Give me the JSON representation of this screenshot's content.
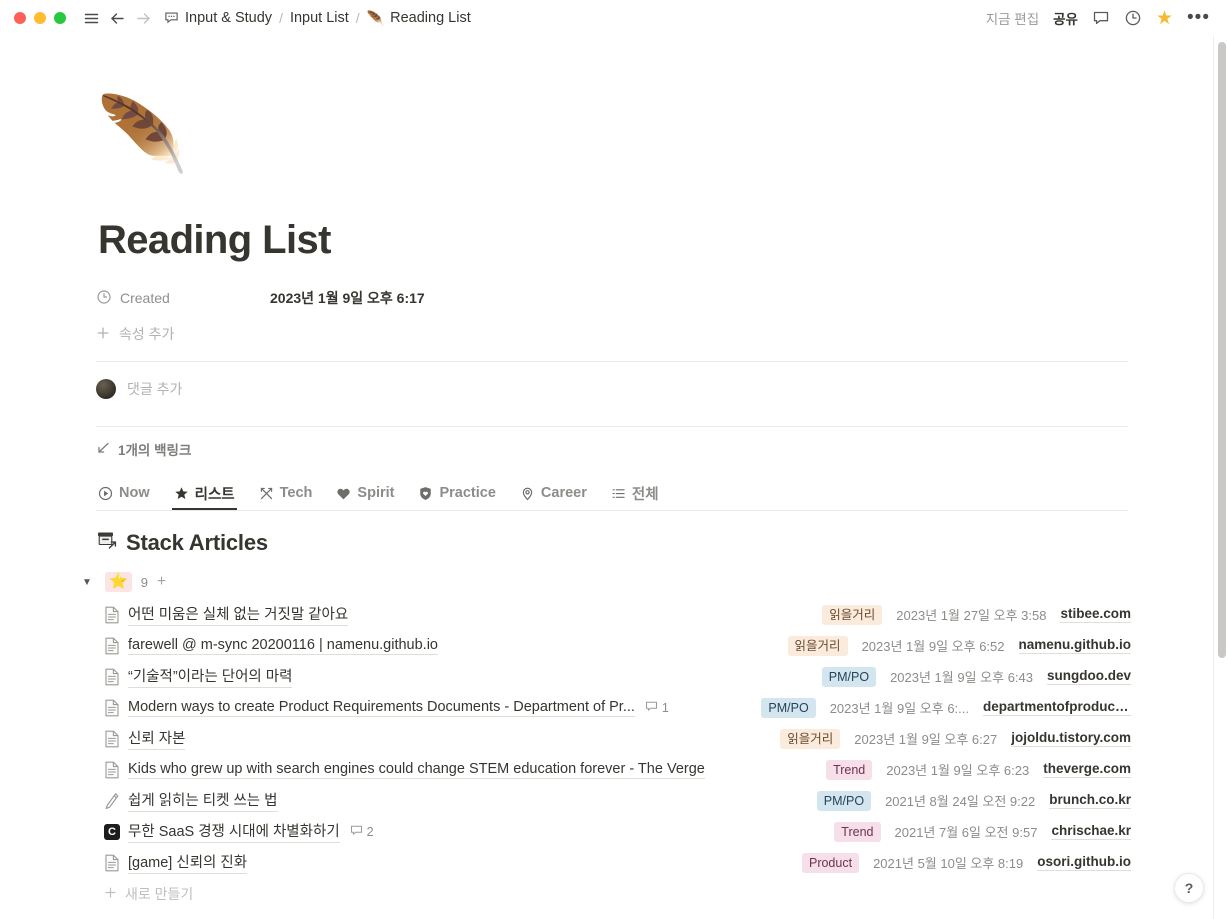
{
  "window": {
    "traffic_lights": [
      "close",
      "minimize",
      "zoom"
    ],
    "nav": {
      "menu": "hamburger-icon",
      "back": "back-arrow-icon",
      "forward": "forward-arrow-icon"
    },
    "breadcrumb": [
      {
        "icon": "speech-bubble",
        "label": "Input & Study"
      },
      {
        "icon": "",
        "label": "Input List"
      },
      {
        "icon": "feather",
        "label": "Reading List"
      }
    ],
    "separator": "/",
    "right": {
      "edit_status": "지금 편집",
      "share": "공유",
      "comment_icon": "comment-icon",
      "history_icon": "clock-history-icon",
      "favorite_icon": "star-icon",
      "more_icon": "more-horizontal-icon"
    }
  },
  "page": {
    "emoji": "🪶",
    "title": "Reading List",
    "properties": [
      {
        "icon": "clock-icon",
        "label": "Created",
        "value": "2023년 1월 9일 오후 6:17"
      }
    ],
    "add_property": "속성 추가",
    "comment_placeholder": "댓글 추가",
    "backlinks": "1개의 백링크"
  },
  "tabs": [
    {
      "icon": "play-circle",
      "label": "Now",
      "active": false
    },
    {
      "icon": "star",
      "label": "리스트",
      "active": true
    },
    {
      "icon": "crossed-arrows",
      "label": "Tech",
      "active": false
    },
    {
      "icon": "heart",
      "label": "Spirit",
      "active": false
    },
    {
      "icon": "shield-heart",
      "label": "Practice",
      "active": false
    },
    {
      "icon": "map-pin",
      "label": "Career",
      "active": false
    },
    {
      "icon": "list",
      "label": "전체",
      "active": false
    }
  ],
  "section": {
    "emoji": "🗃",
    "heading": "Stack Articles",
    "group": {
      "badge_emoji": "⭐",
      "count": "9",
      "add": "+"
    },
    "new_label": "새로 만들기"
  },
  "colors": {
    "tag_orange_bg": "#faebdd",
    "tag_orange_fg": "#6b4b2f",
    "tag_blue_bg": "#d3e5ef",
    "tag_blue_fg": "#27435a",
    "tag_pink_bg": "#f6dfe8",
    "tag_pink_fg": "#6b3550",
    "accent_star": "#f5b932"
  },
  "rows": [
    {
      "icon": "document",
      "title": "어떤 미움은 실체 없는 거짓말 같아요",
      "comments": "",
      "tag": "읽을거리",
      "tag_color": "orange",
      "date": "2023년 1월 27일 오후 3:58",
      "domain": "stibee.com"
    },
    {
      "icon": "document",
      "title": "farewell @ m-sync 20200116 | namenu.github.io",
      "comments": "",
      "tag": "읽을거리",
      "tag_color": "orange",
      "date": "2023년 1월 9일 오후 6:52",
      "domain": "namenu.github.io"
    },
    {
      "icon": "document",
      "title": "“기술적”이라는 단어의 마력",
      "comments": "",
      "tag": "PM/PO",
      "tag_color": "blue",
      "date": "2023년 1월 9일 오후 6:43",
      "domain": "sungdoo.dev"
    },
    {
      "icon": "document",
      "title": "Modern ways to create Product Requirements Documents - Department of Pr...",
      "comments": "1",
      "tag": "PM/PO",
      "tag_color": "blue",
      "date": "2023년 1월 9일 오후 6:...",
      "domain": "departmentofproduct.c..."
    },
    {
      "icon": "document",
      "title": "신뢰 자본",
      "comments": "",
      "tag": "읽을거리",
      "tag_color": "orange",
      "date": "2023년 1월 9일 오후 6:27",
      "domain": "jojoldu.tistory.com"
    },
    {
      "icon": "document",
      "title": "Kids who grew up with search engines could change STEM education forever - The Verge",
      "comments": "",
      "tag": "Trend",
      "tag_color": "pink",
      "date": "2023년 1월 9일 오후 6:23",
      "domain": "theverge.com"
    },
    {
      "icon": "pen",
      "title": "쉽게 읽히는 티켓 쓰는 법",
      "comments": "",
      "tag": "PM/PO",
      "tag_color": "blue",
      "date": "2021년 8월 24일 오전 9:22",
      "domain": "brunch.co.kr"
    },
    {
      "icon": "c-badge",
      "title": "무한 SaaS 경쟁 시대에 차별화하기",
      "comments": "2",
      "tag": "Trend",
      "tag_color": "pink",
      "date": "2021년 7월 6일 오전 9:57",
      "domain": "chrischae.kr"
    },
    {
      "icon": "document",
      "title": "[game] 신뢰의 진화",
      "comments": "",
      "tag": "Product",
      "tag_color": "pink",
      "date": "2021년 5월 10일 오후 8:19",
      "domain": "osori.github.io"
    }
  ],
  "help": {
    "label": "?"
  }
}
